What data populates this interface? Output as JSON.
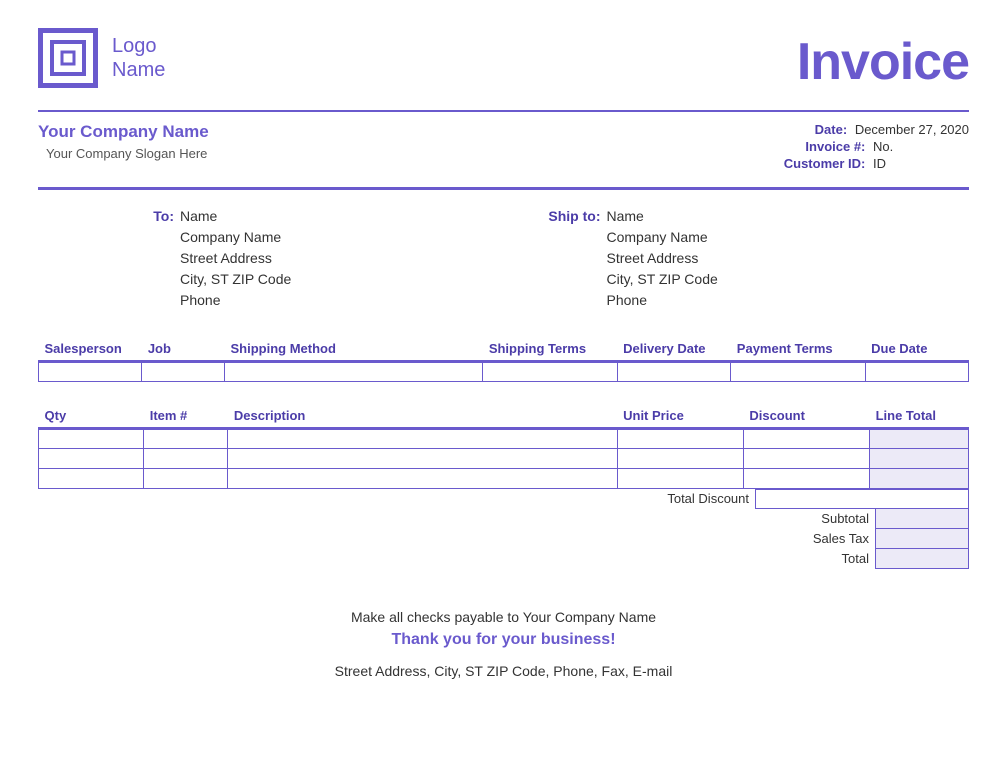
{
  "header": {
    "logo_line1": "Logo",
    "logo_line2": "Name",
    "title": "Invoice"
  },
  "company": {
    "name": "Your Company Name",
    "slogan": "Your Company Slogan Here"
  },
  "meta": {
    "date_label": "Date:",
    "date_value": "December 27, 2020",
    "invoice_label": "Invoice #:",
    "invoice_value": "No.",
    "customer_label": "Customer ID:",
    "customer_value": "ID"
  },
  "bill_to": {
    "label": "To:",
    "name": "Name",
    "company": "Company Name",
    "street": "Street Address",
    "city": "City, ST  ZIP Code",
    "phone": "Phone"
  },
  "ship_to": {
    "label": "Ship to:",
    "name": "Name",
    "company": "Company Name",
    "street": "Street Address",
    "city": "City, ST  ZIP Code",
    "phone": "Phone"
  },
  "ship_table": {
    "headers": [
      "Salesperson",
      "Job",
      "Shipping Method",
      "Shipping Terms",
      "Delivery Date",
      "Payment Terms",
      "Due Date"
    ],
    "row": [
      "",
      "",
      "",
      "",
      "",
      "",
      ""
    ]
  },
  "items_table": {
    "headers": [
      "Qty",
      "Item #",
      "Description",
      "Unit Price",
      "Discount",
      "Line Total"
    ],
    "rows": [
      [
        "",
        "",
        "",
        "",
        "",
        ""
      ],
      [
        "",
        "",
        "",
        "",
        "",
        ""
      ],
      [
        "",
        "",
        "",
        "",
        "",
        ""
      ]
    ]
  },
  "totals": {
    "total_discount_label": "Total Discount",
    "total_discount_value": "",
    "subtotal_label": "Subtotal",
    "subtotal_value": "",
    "sales_tax_label": "Sales Tax",
    "sales_tax_value": "",
    "total_label": "Total",
    "total_value": ""
  },
  "footer": {
    "checks": "Make all checks payable to Your Company Name",
    "thanks": "Thank you for your business!",
    "contact": "Street Address, City, ST  ZIP Code,  Phone,  Fax,  E-mail"
  }
}
